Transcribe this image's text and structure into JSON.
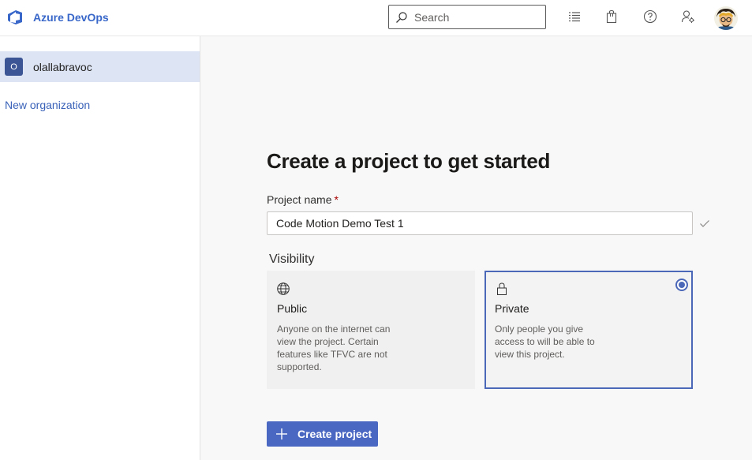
{
  "header": {
    "brand_name": "Azure DevOps",
    "search_placeholder": "Search",
    "icons": [
      "product-logo-icon",
      "search-icon",
      "work-items-icon",
      "marketplace-bag-icon",
      "help-icon",
      "user-settings-icon",
      "user-avatar"
    ]
  },
  "sidebar": {
    "organization": {
      "badge": "O",
      "name": "olallabravoc"
    },
    "new_org_link": "New organization"
  },
  "main": {
    "title": "Create a project to get started",
    "project_name_label": "Project name",
    "required_marker": "*",
    "project_name_value": "Code Motion Demo Test 1",
    "visibility_label": "Visibility",
    "options": [
      {
        "title": "Public",
        "description": "Anyone on the internet can view the project. Certain features like TFVC are not supported.",
        "icon": "globe-icon",
        "selected": false
      },
      {
        "title": "Private",
        "description": "Only people you give access to will be able to view this project.",
        "icon": "lock-icon",
        "selected": true
      }
    ],
    "create_button_label": "Create project"
  },
  "colors": {
    "accent": "#4a67c2",
    "brand_text": "#3867c9",
    "selected_row": "#dde5f5",
    "org_badge": "#3c5594",
    "required": "#a80000"
  }
}
